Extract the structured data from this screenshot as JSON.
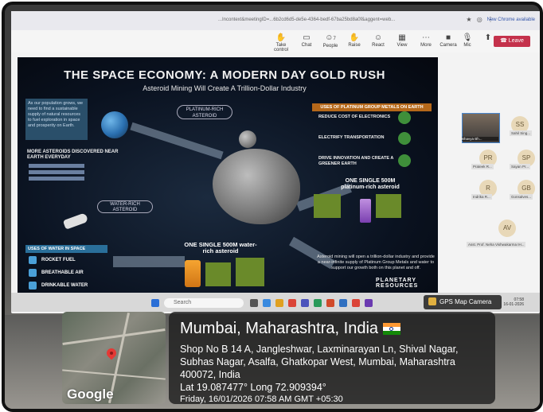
{
  "browser": {
    "url_fragment": "...Incontext&meetingID=...6b2cd6d5-de5e-4364-bedf-67ba25bd8a0f&aggent=web...",
    "new_chrome_label": "New Chrome available"
  },
  "meeting_toolbar": {
    "take_control": "Take control",
    "chat": "Chat",
    "people": "People",
    "people_count": "7",
    "raise": "Raise",
    "react": "React",
    "view": "View",
    "more": "More",
    "camera": "Camera",
    "mic": "Mic",
    "leave": "Leave"
  },
  "slide": {
    "title": "THE SPACE ECONOMY: A MODERN DAY GOLD RUSH",
    "subtitle": "Asteroid Mining Will Create A Trillion-Dollar Industry",
    "intro_box": "As our population grows, we need to find a sustainable supply of natural resources to fuel exploration in space and prosperity on Earth.",
    "platinum_label": "PLATINUM-RICH ASTEROID",
    "pgm_header": "USES OF PLATINUM GROUP METALS ON EARTH",
    "pgm_uses": [
      "REDUCE COST OF ELECTRONICS",
      "ELECTRIFY TRANSPORTATION",
      "DRIVE INNOVATION AND CREATE A GREENER EARTH"
    ],
    "stats_title": "MORE ASTEROIDS DISCOVERED NEAR EARTH EVERYDAY",
    "water_label": "WATER-RICH ASTEROID",
    "water_header": "USES OF WATER IN SPACE",
    "water_uses": [
      "ROCKET FUEL",
      "BREATHABLE AIR",
      "DRINKABLE WATER"
    ],
    "water_caption": "ONE SINGLE 500M water-rich asteroid",
    "platinum_caption": "ONE SINGLE 500M platinum-rich asteroid",
    "bottom_text": "Asteroid mining will open a trillion-dollar industry and provide a near-infinite supply of Platinum Group Metals and water to support our growth both on this planet and off.",
    "brand": "PLANETARY RESOURCES"
  },
  "participants": [
    {
      "initials": "",
      "name": "Bhavya Bh..."
    },
    {
      "initials": "SS",
      "name": "Sahil Sing..."
    },
    {
      "initials": "PR",
      "name": "Prateek R..."
    },
    {
      "initials": "SP",
      "name": "Sayan Pr..."
    },
    {
      "initials": "R",
      "name": "Indrika R..."
    },
    {
      "initials": "GB",
      "name": "Gonsalves..."
    },
    {
      "initials": "AV",
      "name": "Asst. Prof. Neha Vishwakarma IH..."
    }
  ],
  "taskbar": {
    "search_placeholder": "Search",
    "time": "07:58",
    "date": "16-01-2026"
  },
  "gps_badge": "GPS Map Camera",
  "map": {
    "logo": "Google"
  },
  "location": {
    "title": "Mumbai, Maharashtra, India",
    "address_line1": "Shop No B 14 A, Jangleshwar, Laxminarayan Ln, Shival Nagar,",
    "address_line2": "Subhas Nagar, Asalfa, Ghatkopar West, Mumbai, Maharashtra",
    "address_line3": "400072, India",
    "coords": "Lat 19.087477° Long 72.909394°",
    "datetime": "Friday, 16/01/2026 07:58 AM GMT +05:30"
  }
}
